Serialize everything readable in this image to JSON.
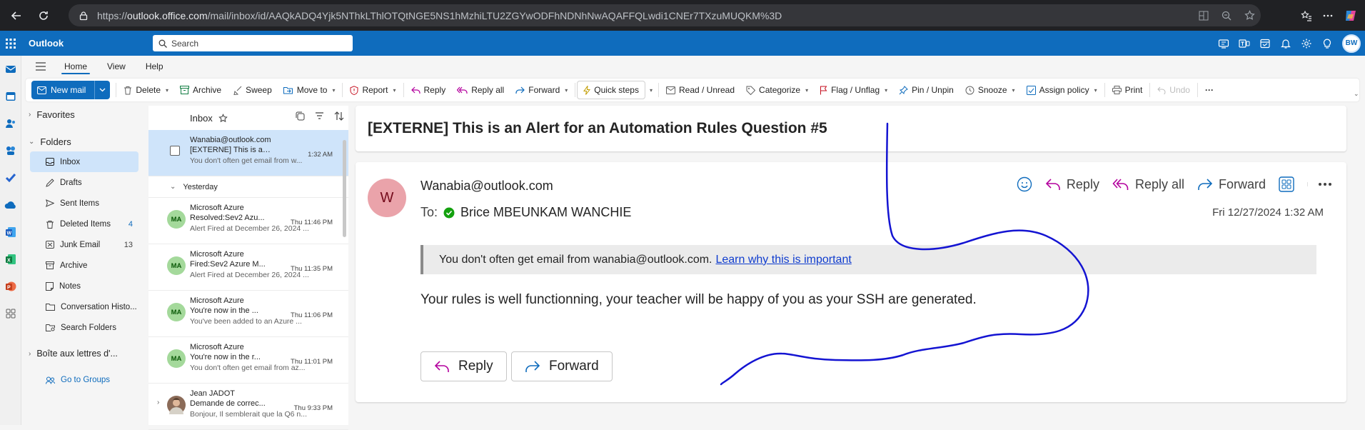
{
  "browser": {
    "url_prefix": "https://",
    "url_domain": "outlook.office.com",
    "url_path": "/mail/inbox/id/AAQkADQ4Yjk5NThkLThlOTQtNGE5NS1hMzhiLTU2ZGYwODFhNDNhNwAQAFFQLwdi1CNEr7TXzuMUQKM%3D"
  },
  "appbar": {
    "brand": "Outlook",
    "search_placeholder": "Search",
    "user_initials": "BW"
  },
  "ribbon": {
    "tabs": [
      "Home",
      "View",
      "Help"
    ],
    "new_mail": "New mail",
    "delete": "Delete",
    "archive": "Archive",
    "sweep": "Sweep",
    "move_to": "Move to",
    "report": "Report",
    "reply": "Reply",
    "reply_all": "Reply all",
    "forward": "Forward",
    "quick_steps": "Quick steps",
    "read_unread": "Read / Unread",
    "categorize": "Categorize",
    "flag": "Flag / Unflag",
    "pin": "Pin / Unpin",
    "snooze": "Snooze",
    "assign_policy": "Assign policy",
    "print": "Print",
    "undo": "Undo",
    "more": "···"
  },
  "folders": {
    "favorites": "Favorites",
    "folders": "Folders",
    "items": [
      {
        "label": "Inbox",
        "count": ""
      },
      {
        "label": "Drafts",
        "count": ""
      },
      {
        "label": "Sent Items",
        "count": ""
      },
      {
        "label": "Deleted Items",
        "count": "4"
      },
      {
        "label": "Junk Email",
        "count": "13"
      },
      {
        "label": "Archive",
        "count": ""
      },
      {
        "label": "Notes",
        "count": ""
      },
      {
        "label": "Conversation Histo...",
        "count": ""
      },
      {
        "label": "Search Folders",
        "count": ""
      }
    ],
    "shared": "Boîte aux lettres d'...",
    "go_to_groups": "Go to Groups"
  },
  "message_list": {
    "title": "Inbox",
    "day_header": "Yesterday",
    "messages": [
      {
        "from": "Wanabia@outlook.com",
        "subject": "[EXTERNE] This is an Al...",
        "time": "1:32 AM",
        "preview": "You don't often get email from w...",
        "avatar": ""
      },
      {
        "from": "Microsoft Azure",
        "subject": "Resolved:Sev2 Azu...",
        "time": "Thu 11:46 PM",
        "preview": "Alert Fired at December 26, 2024 ...",
        "avatar": "MA"
      },
      {
        "from": "Microsoft Azure",
        "subject": "Fired:Sev2 Azure M...",
        "time": "Thu 11:35 PM",
        "preview": "Alert Fired at December 26, 2024 ...",
        "avatar": "MA"
      },
      {
        "from": "Microsoft Azure",
        "subject": "You're now in the ...",
        "time": "Thu 11:06 PM",
        "preview": "You've been added to an Azure ...",
        "avatar": "MA"
      },
      {
        "from": "Microsoft Azure",
        "subject": "You're now in the r...",
        "time": "Thu 11:01 PM",
        "preview": "You don't often get email from az...",
        "avatar": "MA"
      },
      {
        "from": "Jean JADOT",
        "subject": "Demande de correc...",
        "time": "Thu 9:33 PM",
        "preview": "Bonjour, Il semblerait que la Q6 n...",
        "avatar": ""
      }
    ]
  },
  "reading": {
    "subject": "[EXTERNE] This is an Alert for an Automation Rules Question #5",
    "avatar": "W",
    "sender": "Wanabia@outlook.com",
    "to_label": "To:",
    "to_name": "Brice MBEUNKAM WANCHIE",
    "reply": "Reply",
    "reply_all": "Reply all",
    "forward": "Forward",
    "date": "Fri 12/27/2024 1:32 AM",
    "notice": "You don't often get email from wanabia@outlook.com.",
    "notice_link": "Learn why this is important",
    "body": "Your rules is well functionning, your teacher will be happy of you as your SSH are generated.",
    "btn_reply": "Reply",
    "btn_forward": "Forward"
  },
  "colors": {
    "brand_blue": "#0f6cbd",
    "selected": "#cfe4fa",
    "ink": "#1414d2",
    "avatar_pink": "#eaa3aa"
  }
}
